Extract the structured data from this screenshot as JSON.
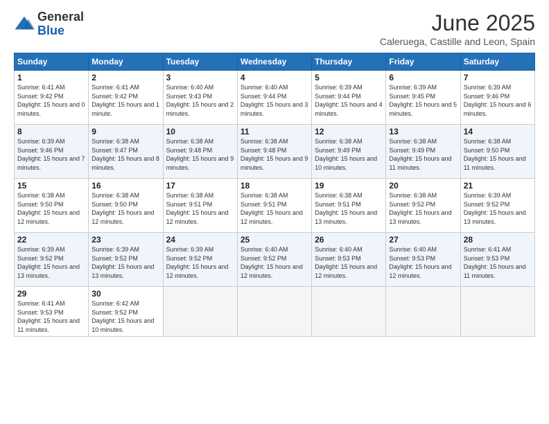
{
  "logo": {
    "general": "General",
    "blue": "Blue"
  },
  "header": {
    "title": "June 2025",
    "subtitle": "Caleruega, Castille and Leon, Spain"
  },
  "weekdays": [
    "Sunday",
    "Monday",
    "Tuesday",
    "Wednesday",
    "Thursday",
    "Friday",
    "Saturday"
  ],
  "weeks": [
    [
      {
        "day": "1",
        "sunrise": "6:41 AM",
        "sunset": "9:42 PM",
        "daylight": "15 hours and 0 minutes."
      },
      {
        "day": "2",
        "sunrise": "6:41 AM",
        "sunset": "9:42 PM",
        "daylight": "15 hours and 1 minute."
      },
      {
        "day": "3",
        "sunrise": "6:40 AM",
        "sunset": "9:43 PM",
        "daylight": "15 hours and 2 minutes."
      },
      {
        "day": "4",
        "sunrise": "6:40 AM",
        "sunset": "9:44 PM",
        "daylight": "15 hours and 3 minutes."
      },
      {
        "day": "5",
        "sunrise": "6:39 AM",
        "sunset": "9:44 PM",
        "daylight": "15 hours and 4 minutes."
      },
      {
        "day": "6",
        "sunrise": "6:39 AM",
        "sunset": "9:45 PM",
        "daylight": "15 hours and 5 minutes."
      },
      {
        "day": "7",
        "sunrise": "6:39 AM",
        "sunset": "9:46 PM",
        "daylight": "15 hours and 6 minutes."
      }
    ],
    [
      {
        "day": "8",
        "sunrise": "6:39 AM",
        "sunset": "9:46 PM",
        "daylight": "15 hours and 7 minutes."
      },
      {
        "day": "9",
        "sunrise": "6:38 AM",
        "sunset": "9:47 PM",
        "daylight": "15 hours and 8 minutes."
      },
      {
        "day": "10",
        "sunrise": "6:38 AM",
        "sunset": "9:48 PM",
        "daylight": "15 hours and 9 minutes."
      },
      {
        "day": "11",
        "sunrise": "6:38 AM",
        "sunset": "9:48 PM",
        "daylight": "15 hours and 9 minutes."
      },
      {
        "day": "12",
        "sunrise": "6:38 AM",
        "sunset": "9:49 PM",
        "daylight": "15 hours and 10 minutes."
      },
      {
        "day": "13",
        "sunrise": "6:38 AM",
        "sunset": "9:49 PM",
        "daylight": "15 hours and 11 minutes."
      },
      {
        "day": "14",
        "sunrise": "6:38 AM",
        "sunset": "9:50 PM",
        "daylight": "15 hours and 11 minutes."
      }
    ],
    [
      {
        "day": "15",
        "sunrise": "6:38 AM",
        "sunset": "9:50 PM",
        "daylight": "15 hours and 12 minutes."
      },
      {
        "day": "16",
        "sunrise": "6:38 AM",
        "sunset": "9:50 PM",
        "daylight": "15 hours and 12 minutes."
      },
      {
        "day": "17",
        "sunrise": "6:38 AM",
        "sunset": "9:51 PM",
        "daylight": "15 hours and 12 minutes."
      },
      {
        "day": "18",
        "sunrise": "6:38 AM",
        "sunset": "9:51 PM",
        "daylight": "15 hours and 12 minutes."
      },
      {
        "day": "19",
        "sunrise": "6:38 AM",
        "sunset": "9:51 PM",
        "daylight": "15 hours and 13 minutes."
      },
      {
        "day": "20",
        "sunrise": "6:38 AM",
        "sunset": "9:52 PM",
        "daylight": "15 hours and 13 minutes."
      },
      {
        "day": "21",
        "sunrise": "6:39 AM",
        "sunset": "9:52 PM",
        "daylight": "15 hours and 13 minutes."
      }
    ],
    [
      {
        "day": "22",
        "sunrise": "6:39 AM",
        "sunset": "9:52 PM",
        "daylight": "15 hours and 13 minutes."
      },
      {
        "day": "23",
        "sunrise": "6:39 AM",
        "sunset": "9:52 PM",
        "daylight": "15 hours and 13 minutes."
      },
      {
        "day": "24",
        "sunrise": "6:39 AM",
        "sunset": "9:52 PM",
        "daylight": "15 hours and 12 minutes."
      },
      {
        "day": "25",
        "sunrise": "6:40 AM",
        "sunset": "9:52 PM",
        "daylight": "15 hours and 12 minutes."
      },
      {
        "day": "26",
        "sunrise": "6:40 AM",
        "sunset": "9:53 PM",
        "daylight": "15 hours and 12 minutes."
      },
      {
        "day": "27",
        "sunrise": "6:40 AM",
        "sunset": "9:53 PM",
        "daylight": "15 hours and 12 minutes."
      },
      {
        "day": "28",
        "sunrise": "6:41 AM",
        "sunset": "9:53 PM",
        "daylight": "15 hours and 11 minutes."
      }
    ],
    [
      {
        "day": "29",
        "sunrise": "6:41 AM",
        "sunset": "9:53 PM",
        "daylight": "15 hours and 11 minutes."
      },
      {
        "day": "30",
        "sunrise": "6:42 AM",
        "sunset": "9:52 PM",
        "daylight": "15 hours and 10 minutes."
      },
      null,
      null,
      null,
      null,
      null
    ]
  ]
}
